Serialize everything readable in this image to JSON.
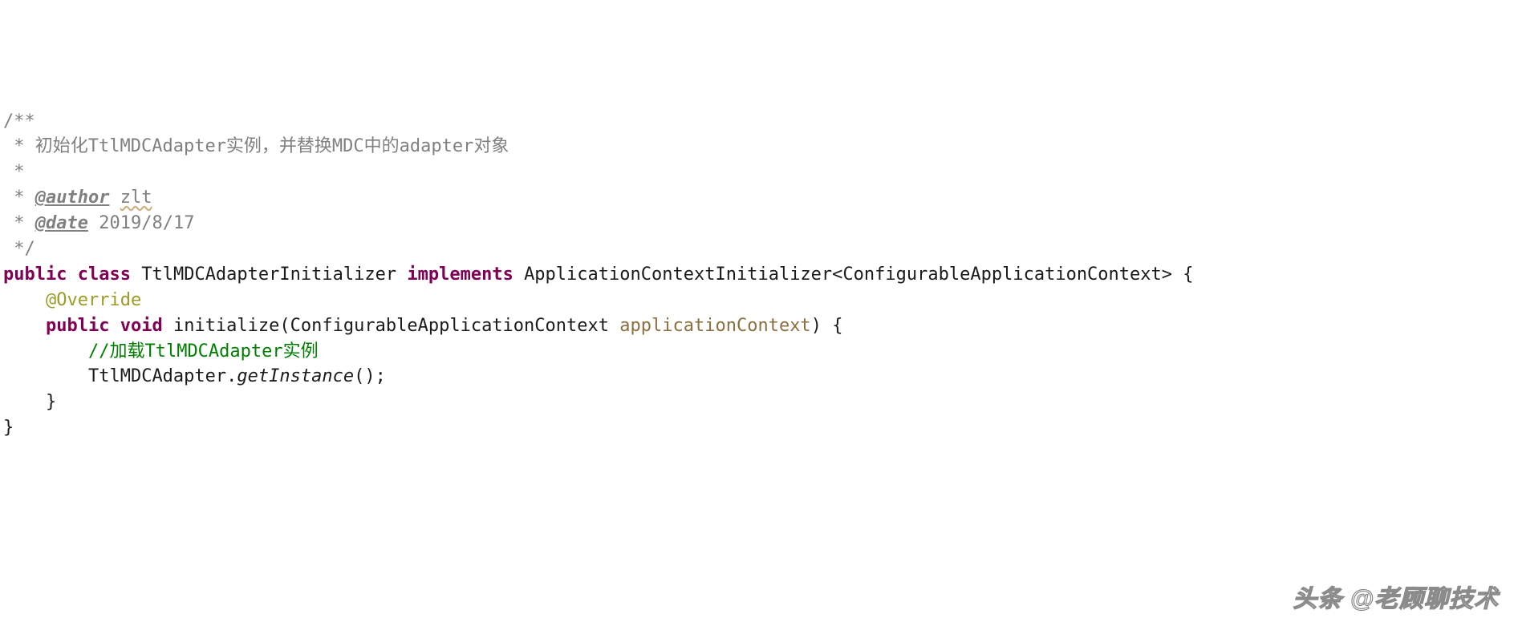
{
  "javadoc": {
    "open": "/**",
    "line_star": " * ",
    "line_star_only": " *",
    "description": "初始化TtlMDCAdapter实例，并替换MDC中的adapter对象",
    "author_tag": "@author",
    "author_value": "zlt",
    "date_tag": "@date",
    "date_value": "2019/8/17",
    "close": " */"
  },
  "code": {
    "kw_public": "public",
    "kw_class": "class",
    "class_name": "TtlMDCAdapterInitializer",
    "kw_implements": "implements",
    "iface": "ApplicationContextInitializer",
    "generic": "ConfigurableApplicationContext",
    "brace_open": "{",
    "brace_close": "}",
    "ann_override": "@Override",
    "kw_void": "void",
    "method_name": "initialize",
    "param_type": "ConfigurableApplicationContext",
    "param_name": "applicationContext",
    "inline_comment": "//加载TtlMDCAdapter实例",
    "stmt_receiver": "TtlMDCAdapter",
    "stmt_method": "getInstance",
    "stmt_tail": "();"
  },
  "watermark": "头条 @老顾聊技术"
}
